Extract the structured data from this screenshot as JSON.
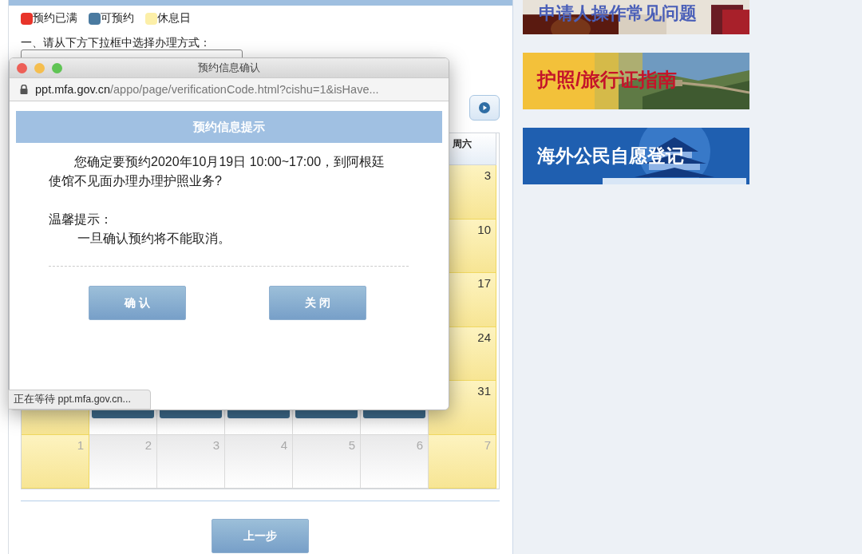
{
  "legend": [
    {
      "label": "预约已满",
      "color": "#e8342a"
    },
    {
      "label": "可预约",
      "color": "#4a7aa0"
    },
    {
      "label": "休息日",
      "color": "#fcefa8"
    }
  ],
  "method_prompt": "一、请从下方下拉框中选择办理方式：",
  "calendar": {
    "weekday_header": "周六",
    "weeks": [
      {
        "cells": [
          {
            "day": "3",
            "kind": "rest"
          }
        ]
      },
      {
        "cells": [
          {
            "day": "10",
            "kind": "rest"
          }
        ]
      },
      {
        "cells": [
          {
            "day": "17",
            "kind": "rest"
          }
        ]
      },
      {
        "cells": [
          {
            "day": "24",
            "kind": "rest"
          }
        ]
      },
      {
        "cells": [
          {
            "kind": "rest"
          },
          {
            "kind": "available"
          },
          {
            "kind": "available"
          },
          {
            "kind": "available"
          },
          {
            "kind": "available"
          },
          {
            "kind": "available"
          },
          {
            "day": "31",
            "kind": "rest"
          }
        ]
      },
      {
        "cells": [
          {
            "day": "1",
            "kind": "other_rest"
          },
          {
            "day": "2",
            "kind": "other"
          },
          {
            "day": "3",
            "kind": "other"
          },
          {
            "day": "4",
            "kind": "other"
          },
          {
            "day": "5",
            "kind": "other"
          },
          {
            "day": "6",
            "kind": "other"
          },
          {
            "day": "7",
            "kind": "other_rest"
          }
        ]
      }
    ]
  },
  "prev_button": "上一步",
  "banners": [
    {
      "title": "申请人操作常见问题",
      "kind": "passport"
    },
    {
      "title": "护照/旅行证指南",
      "kind": "wall"
    },
    {
      "title": "海外公民自愿登记",
      "kind": "temple"
    }
  ],
  "popup": {
    "title": "预约信息确认",
    "url_host": "ppt.mfa.gov.cn",
    "url_path": "/appo/page/verificationCode.html?cishu=1&isHave...",
    "header": "预约信息提示",
    "message": "您确定要预约2020年10月19日 10:00~17:00，到阿根廷使馆不见面办理办理护照业务?",
    "tip_label": "温馨提示：",
    "tip_text": "一旦确认预约将不能取消。",
    "buttons": [
      "确 认",
      "关 闭"
    ],
    "status": "正在等待 ppt.mfa.gov.cn..."
  }
}
